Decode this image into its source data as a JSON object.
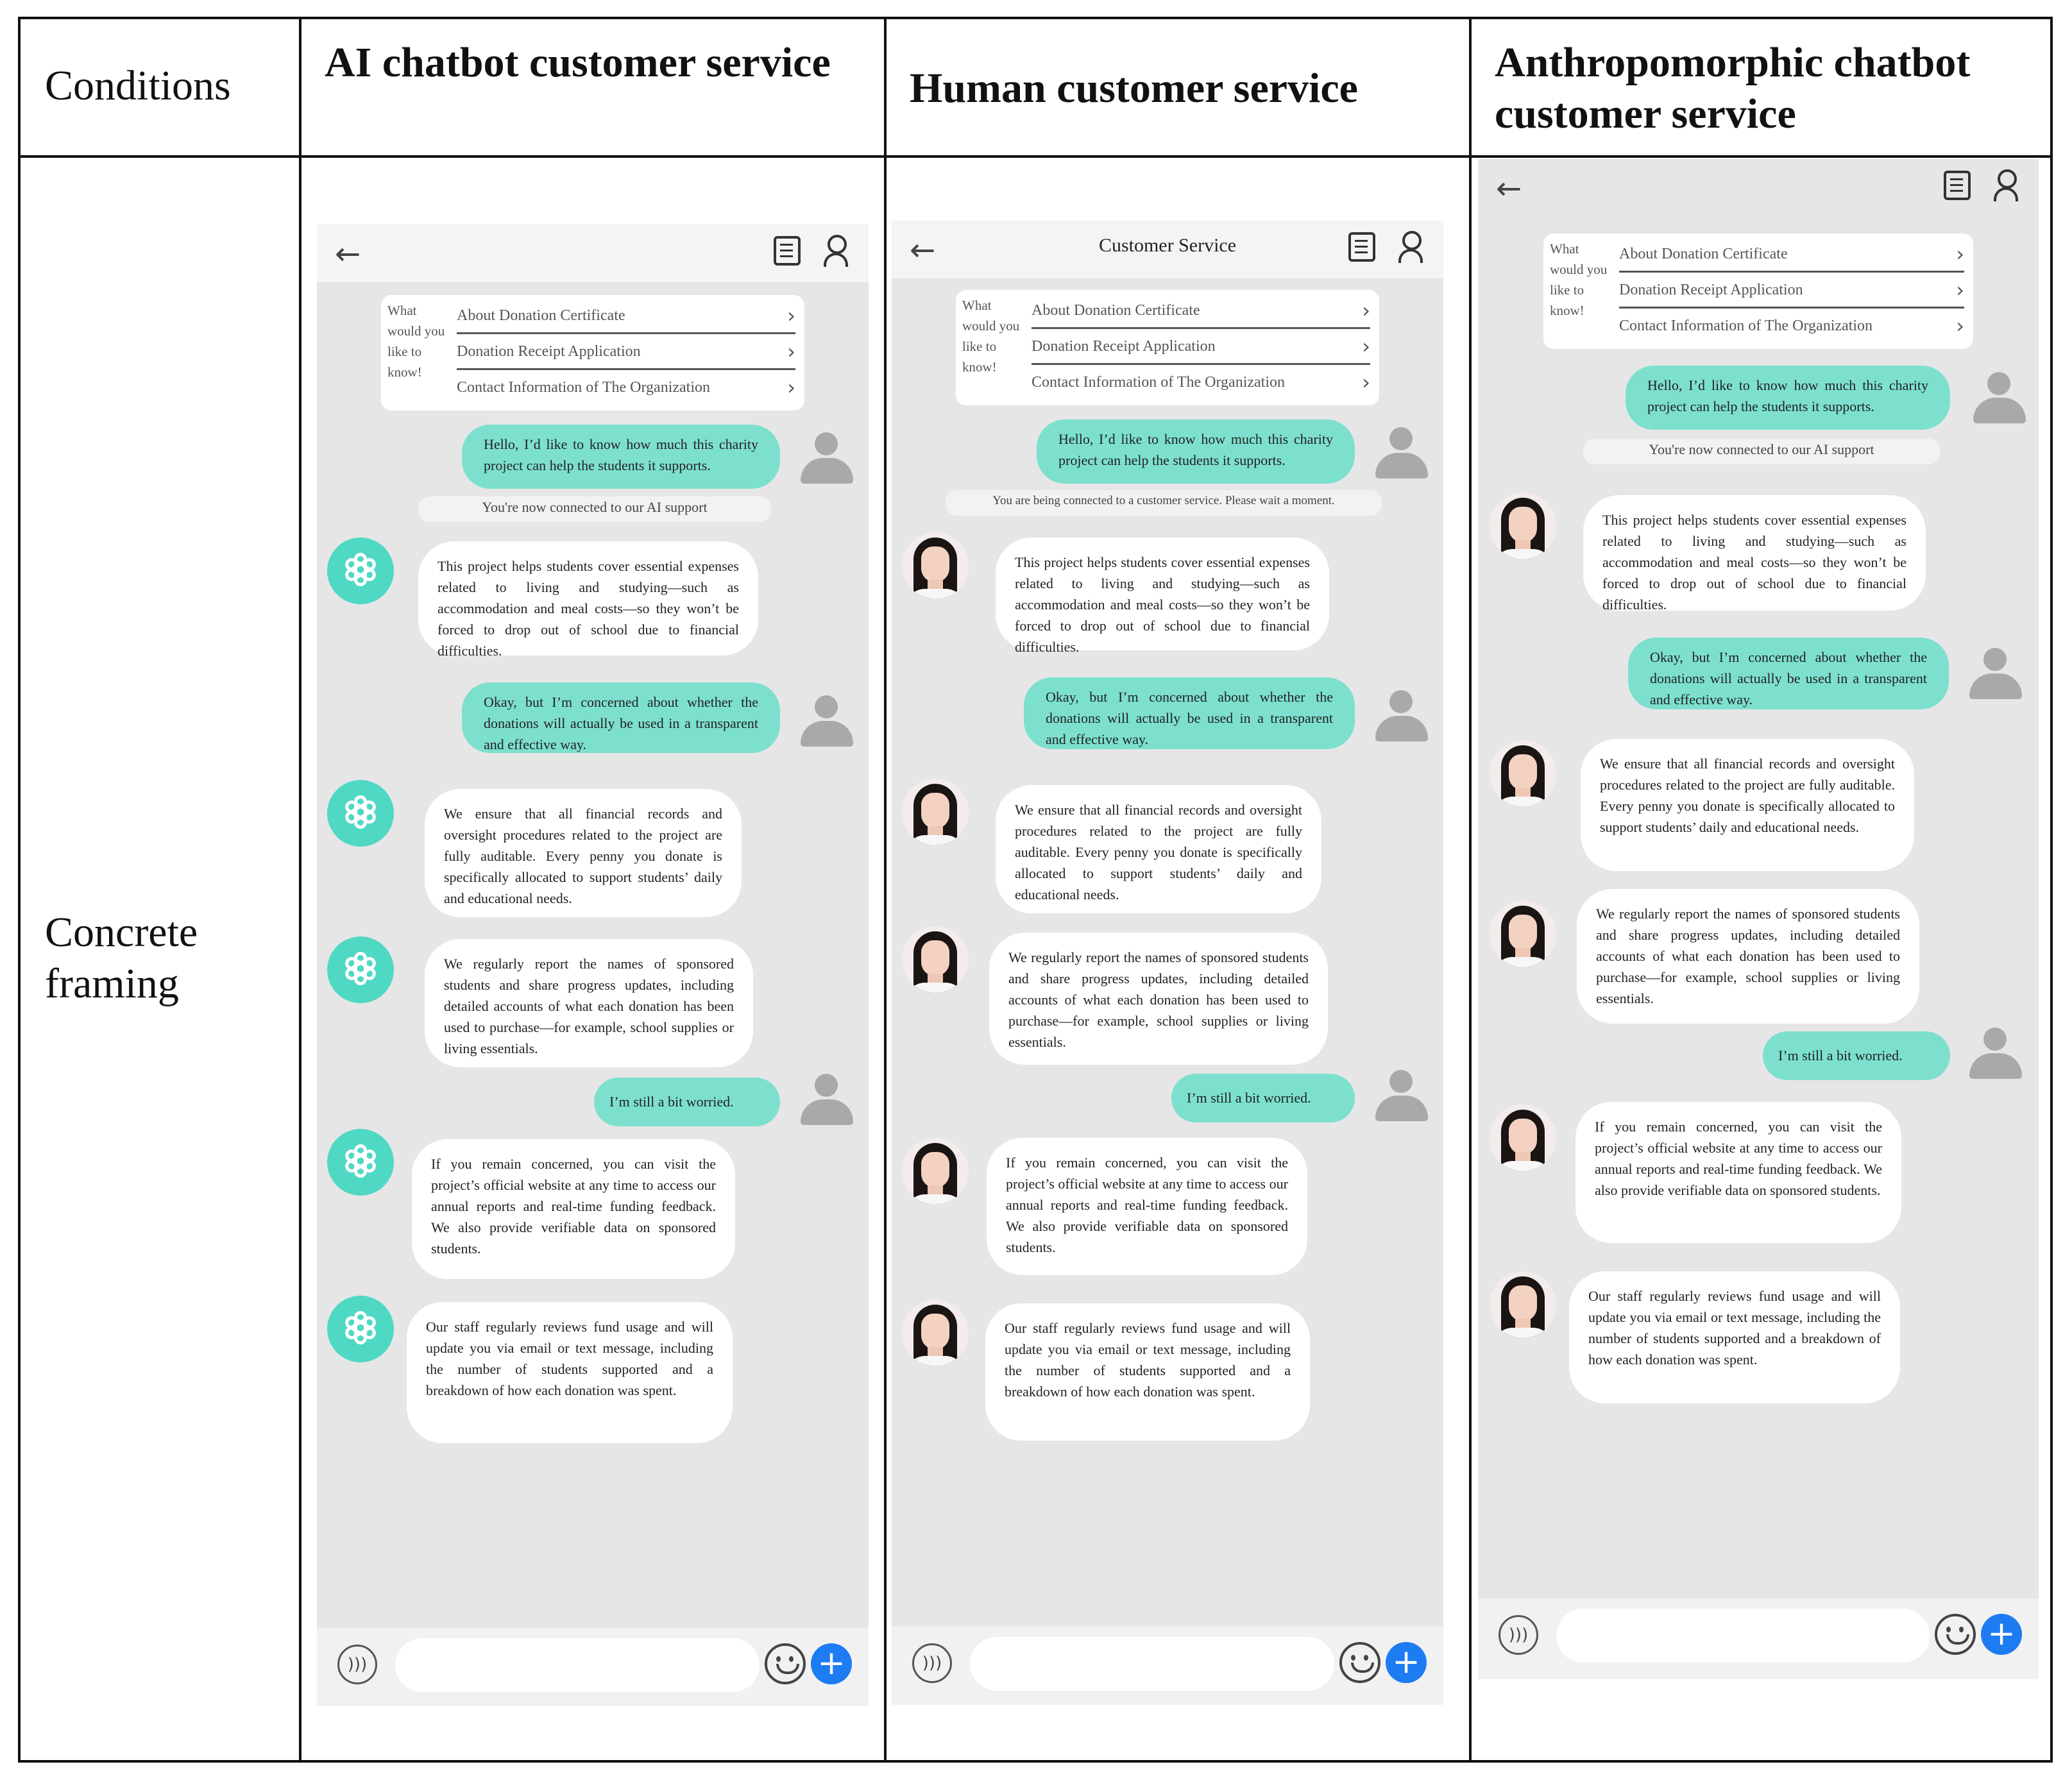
{
  "table": {
    "col_headers": [
      "Conditions",
      "AI chatbot customer service",
      "Human customer service",
      "Anthropomorphic chatbot customer service"
    ],
    "row_label": "Concrete framing"
  },
  "phones": [
    {
      "title": "",
      "menu": {
        "ask": "What would you like to know!",
        "items": [
          "About Donation Certificate",
          "Donation Receipt Application",
          "Contact Information of The Organization"
        ]
      },
      "notice": "You're now connected to our AI support",
      "msgs": [
        "Hello, I’d like to know how much this charity project can help the students it supports.",
        "This project helps students cover essential expenses related to living and studying—such as accommodation and meal costs—so they won’t be forced to drop out of school due to financial difficulties.",
        "Okay, but I’m concerned about whether the donations will actually be used in a transparent and effective way.",
        "We ensure that all financial records and oversight procedures related to the project are fully auditable. Every penny you donate is specifically allocated to support students’ daily and educational needs.",
        "We regularly report the names of sponsored students and share progress updates, including detailed accounts of what each donation has been used to purchase—for example, school supplies or living essentials.",
        "I’m still a bit worried.",
        "If you remain concerned, you can visit the project’s official website at any time to access our annual reports and real-time funding feedback. We also provide verifiable data on sponsored students.",
        "Our staff regularly reviews fund usage and will update you via email or text message, including the number of students supported and a breakdown of how each donation was spent."
      ]
    },
    {
      "title": "Customer Service",
      "menu": {
        "ask": "What would you like to know!",
        "items": [
          "About Donation Certificate",
          "Donation Receipt Application",
          "Contact Information of The Organization"
        ]
      },
      "notice": "You are being connected to a customer service. Please wait a moment.",
      "msgs": [
        "Hello, I’d like to know how much this charity project can help the students it supports.",
        "This project helps students cover essential expenses related to living and studying—such as accommodation and meal costs—so they won’t be forced to drop out of school due to financial difficulties.",
        "Okay, but I’m concerned about whether the donations will actually be used in a transparent and effective way.",
        "We ensure that all financial records and oversight procedures related to the project are fully auditable. Every penny you donate is specifically allocated to support students’ daily and educational needs.",
        "We regularly report the names of sponsored students and share progress updates, including detailed accounts of what each donation has been used to purchase—for example, school supplies or living essentials.",
        "I’m still a bit worried.",
        "If you remain concerned, you can visit the project’s official website at any time to access our annual reports and real-time funding feedback. We also provide verifiable data on sponsored students.",
        "Our staff regularly reviews fund usage and will update you via email or text message, including the number of students supported and a breakdown of how each donation was spent."
      ]
    },
    {
      "title": "",
      "menu": {
        "ask": "What would you like to know!",
        "items": [
          "About Donation Certificate",
          "Donation Receipt Application",
          "Contact Information of The Organization"
        ]
      },
      "notice": "You're now connected to our AI support",
      "msgs": [
        "Hello, I’d like to know how much this charity project can help the students it supports.",
        "This project helps students cover essential expenses related to living and studying—such as accommodation and meal costs—so they won’t be forced to drop out of school due to financial difficulties.",
        "Okay, but I’m concerned about whether the donations will actually be used in a transparent and effective way.",
        "We ensure that all financial records and oversight procedures related to the project are fully auditable. Every penny you donate is specifically allocated to support students’ daily and educational needs.",
        "We regularly report the names of sponsored students and share progress updates, including detailed accounts of what each donation has been used to purchase—for example, school supplies or living essentials.",
        "I’m still a bit worried.",
        "If you remain concerned, you can visit the project’s official website at any time to access our annual reports and real-time funding feedback. We also provide verifiable data on sponsored students.",
        "Our staff regularly reviews fund usage and will update you via email or text message, including the number of students supported and a breakdown of how each donation was spent."
      ]
    }
  ],
  "icons": {
    "back": "back-arrow-icon",
    "card": "document-icon",
    "user": "user-search-icon",
    "voice": "voice-icon",
    "emoji": "emoji-icon",
    "plus": "plus-icon",
    "bot": "chatbot-logo-icon",
    "human": "agent-photo-avatar",
    "user_avatar": "user-avatar-icon"
  },
  "colors": {
    "user_bubble": "#7de0cf",
    "bot_logo": "#4fd8c4",
    "plus_button": "#1e7cf2",
    "phone_bg": "#e6e6e6"
  }
}
